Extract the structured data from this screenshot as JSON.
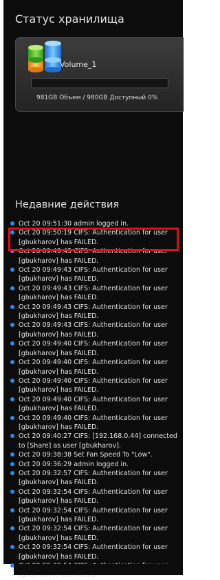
{
  "storage": {
    "title": "Статус хранилища",
    "volume_name": "Volume_1",
    "usage_text": "981GB Объем / 980GB Доступный   0%",
    "usage_percent": 0
  },
  "activity": {
    "title": "Недавние действия",
    "items": [
      "Oct 20 09:51:30 admin logged in.",
      "Oct 20 09:50:19 CIFS: Authentication for user [gbukharov] has FAILED.",
      "Oct 20 09:49:43 CIFS: Authentication for user [gbukharov] has FAILED.",
      "Oct 20 09:49:43 CIFS: Authentication for user [gbukharov] has FAILED.",
      "Oct 20 09:49:43 CIFS: Authentication for user [gbukharov] has FAILED.",
      "Oct 20 09:49:43 CIFS: Authentication for user [gbukharov] has FAILED.",
      "Oct 20 09:49:43 CIFS: Authentication for user [gbukharov] has FAILED.",
      "Oct 20 09:49:40 CIFS: Authentication for user [gbukharov] has FAILED.",
      "Oct 20 09:49:40 CIFS: Authentication for user [gbukharov] has FAILED.",
      "Oct 20 09:49:40 CIFS: Authentication for user [gbukharov] has FAILED.",
      "Oct 20 09:49:40 CIFS: Authentication for user [gbukharov] has FAILED.",
      "Oct 20 09:49:40 CIFS: Authentication for user [gbukharov] has FAILED.",
      "Oct 20 09:40:27 CIFS: [192.168.0.44] connected to [Share] as user [gbukharov].",
      "Oct 20 09:38:38 Set Fan Speed To \"Low\".",
      "Oct 20 09:36:29 admin logged in.",
      "Oct 20 09:32:57 CIFS: Authentication for user [gbukharov] has FAILED.",
      "Oct 20 09:32:54 CIFS: Authentication for user [gbukharov] has FAILED.",
      "Oct 20 09:32:54 CIFS: Authentication for user [gbukharov] has FAILED.",
      "Oct 20 09:32:54 CIFS: Authentication for user [gbukharov] has FAILED.",
      "Oct 20 09:32:54 CIFS: Authentication for user [gbukharov] has FAILED.",
      "Oct 20 09:32:54 CIFS: Authentication for user [gbukharov] has FAILED."
    ]
  },
  "colors": {
    "highlight": "#e0101a",
    "bullet": "#2a8df0"
  },
  "icons": {
    "volume": "database-icon",
    "bullet": "bullet-icon"
  }
}
